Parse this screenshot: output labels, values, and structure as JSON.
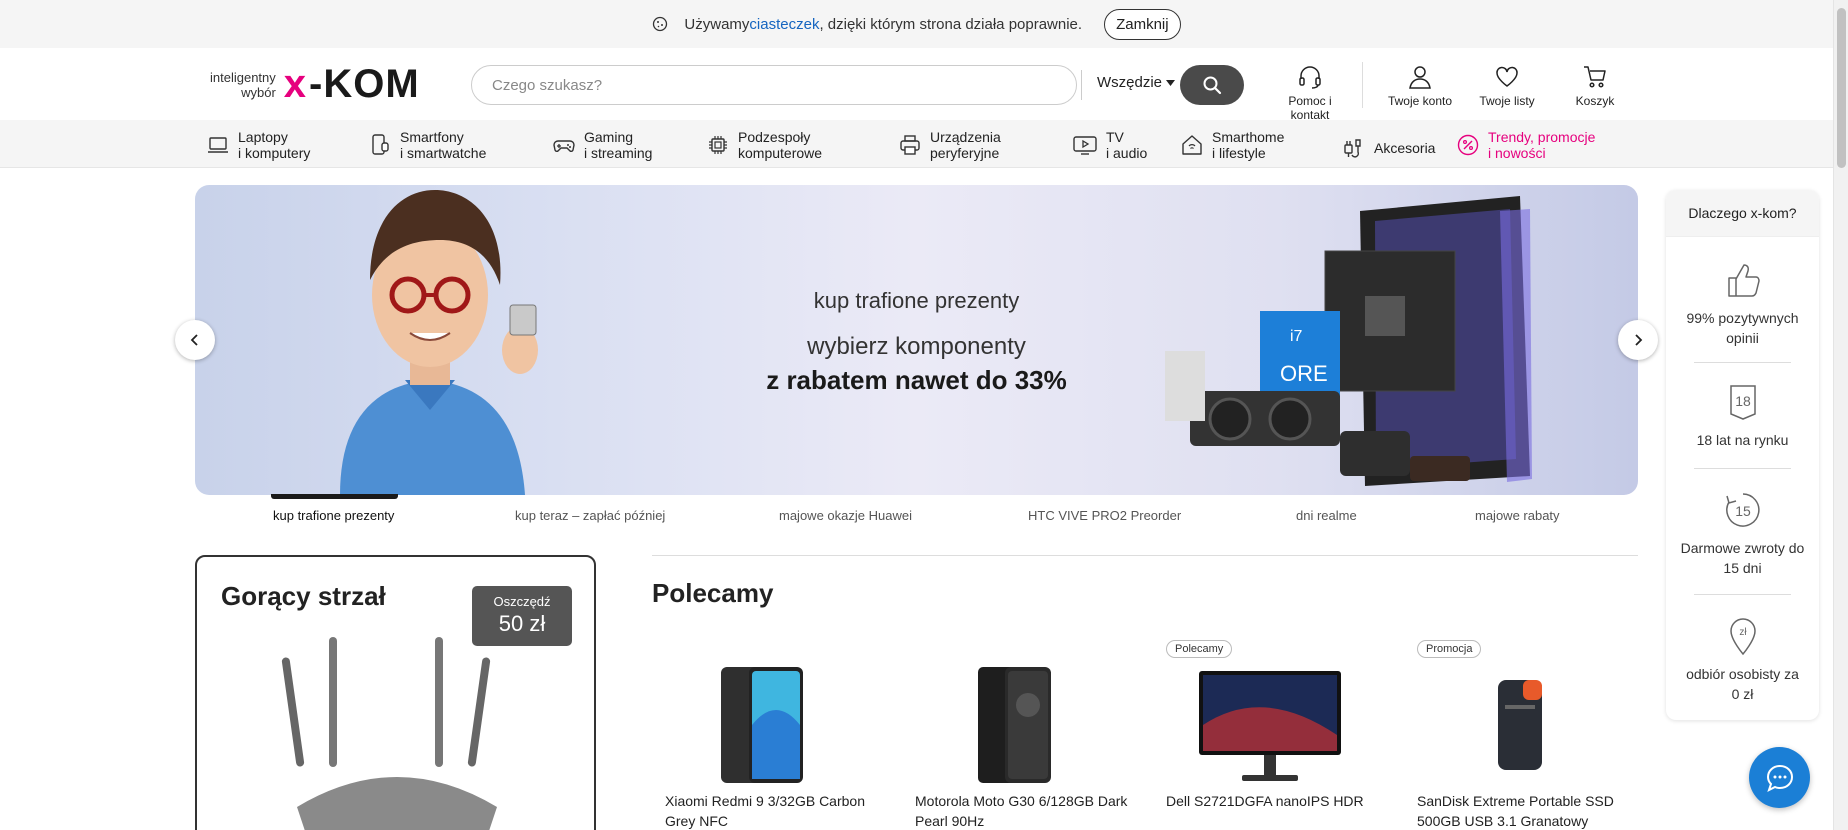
{
  "cookie": {
    "text_before": "Używamy ",
    "link": "ciasteczek",
    "text_after": ", dzięki którym strona działa poprawnie.",
    "close": "Zamknij"
  },
  "header": {
    "logo_tagline_1": "inteligentny",
    "logo_tagline_2": "wybór",
    "logo_x": "x",
    "logo_rest": "-KOM",
    "search_placeholder": "Czego szukasz?",
    "search_scope": "Wszędzie",
    "help": "Pomoc i kontakt",
    "account": "Twoje konto",
    "lists": "Twoje listy",
    "cart": "Koszyk"
  },
  "nav": [
    {
      "l1": "Laptopy",
      "l2": "i komputery",
      "icon": "laptop-icon"
    },
    {
      "l1": "Smartfony",
      "l2": "i smartwatche",
      "icon": "smartphone-icon"
    },
    {
      "l1": "Gaming",
      "l2": "i streaming",
      "icon": "gamepad-icon"
    },
    {
      "l1": "Podzespoły",
      "l2": "komputerowe",
      "icon": "cpu-icon"
    },
    {
      "l1": "Urządzenia",
      "l2": "peryferyjne",
      "icon": "printer-icon"
    },
    {
      "l1": "TV",
      "l2": "i audio",
      "icon": "tv-icon"
    },
    {
      "l1": "Smarthome",
      "l2": "i lifestyle",
      "icon": "home-icon"
    },
    {
      "l1": "Akcesoria",
      "l2": "",
      "icon": "cable-icon"
    },
    {
      "l1": "Trendy, promocje",
      "l2": "i nowości",
      "icon": "percent-icon"
    }
  ],
  "hero": {
    "line1": "kup trafione prezenty",
    "line2": "wybierz komponenty",
    "line3": "z rabatem nawet do 33%"
  },
  "tabs": [
    "kup trafione prezenty",
    "kup teraz – zapłać później",
    "majowe okazje Huawei",
    "HTC VIVE PRO2 Preorder",
    "dni realme",
    "majowe rabaty"
  ],
  "hot": {
    "title": "Gorący strzał",
    "save_label": "Oszczędź",
    "save_value": "50 zł"
  },
  "recommended": {
    "title": "Polecamy",
    "products": [
      {
        "badge": "",
        "name": "Xiaomi Redmi 9 3/32GB Carbon Grey NFC"
      },
      {
        "badge": "",
        "name": "Motorola Moto G30 6/128GB Dark Pearl 90Hz"
      },
      {
        "badge": "Polecamy",
        "name": "Dell S2721DGFA nanoIPS HDR"
      },
      {
        "badge": "Promocja",
        "name": "SanDisk Extreme Portable SSD 500GB USB 3.1 Granatowy"
      }
    ]
  },
  "why": {
    "title": "Dlaczego x-kom?",
    "items": [
      {
        "text": "99% pozytywnych opinii",
        "icon": "thumbs-up-icon"
      },
      {
        "text": "18 lat na rynku",
        "icon": "badge-18-icon",
        "glyph": "18"
      },
      {
        "text": "Darmowe zwroty do 15 dni",
        "icon": "return-15-icon",
        "glyph": "15"
      },
      {
        "text": "odbiór osobisty za 0 zł",
        "icon": "pickup-pin-icon",
        "glyph": "zł"
      }
    ]
  },
  "colors": {
    "brand_pink": "#e6007e",
    "link_blue": "#1565c0",
    "chat_blue": "#1b7fd6",
    "dark_button": "#4a4a4a"
  }
}
